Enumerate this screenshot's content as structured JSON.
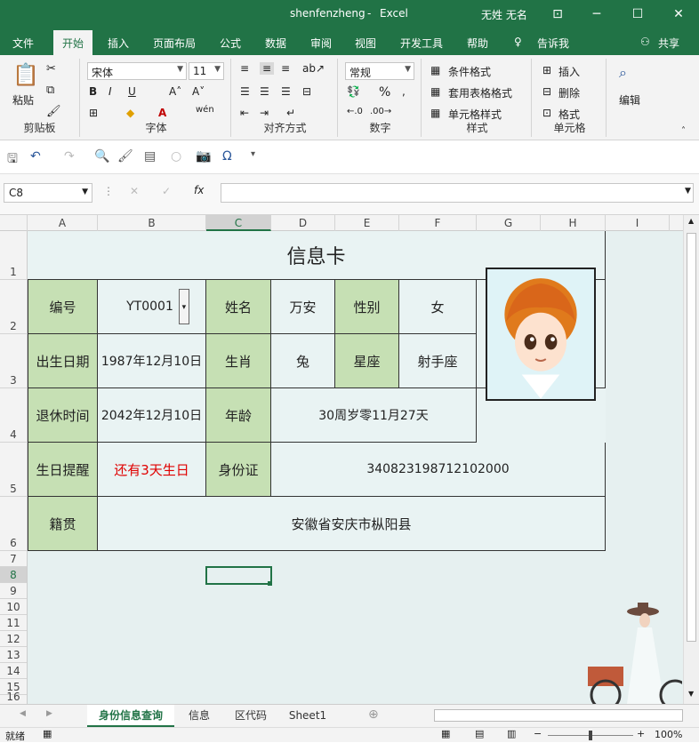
{
  "titlebar": {
    "filename": "shenfenzheng",
    "separator": "-",
    "app": "Excel",
    "user": "无姓 无名"
  },
  "ribbon_tabs": [
    "文件",
    "开始",
    "插入",
    "页面布局",
    "公式",
    "数据",
    "审阅",
    "视图",
    "开发工具",
    "帮助",
    "告诉我",
    "共享"
  ],
  "ribbon": {
    "paste": "粘贴",
    "clipboard": "剪贴板",
    "font_name": "宋体",
    "font_size": "11",
    "font_group": "字体",
    "align_group": "对齐方式",
    "number_format": "常规",
    "number_group": "数字",
    "cond_format": "条件格式",
    "table_format": "套用表格格式",
    "cell_style": "单元格样式",
    "styles_group": "样式",
    "insert": "插入",
    "delete": "删除",
    "format": "格式",
    "cells_group": "单元格",
    "edit": "编辑"
  },
  "formula_bar": {
    "name_box": "C8",
    "formula": ""
  },
  "columns": [
    "A",
    "B",
    "C",
    "D",
    "E",
    "F",
    "G",
    "H",
    "I"
  ],
  "rows": [
    "1",
    "2",
    "3",
    "4",
    "5",
    "6",
    "7",
    "8",
    "9",
    "10",
    "11",
    "12",
    "13",
    "14",
    "15",
    "16"
  ],
  "card": {
    "title": "信息卡",
    "label_id": "编号",
    "id": "YT0001",
    "label_name": "姓名",
    "name": "万安",
    "label_gender": "性别",
    "gender": "女",
    "label_birth": "出生日期",
    "birth": "1987年12月10日",
    "label_zodiac": "生肖",
    "zodiac": "兔",
    "label_star": "星座",
    "star": "射手座",
    "label_retire": "退休时间",
    "retire": "2042年12月10日",
    "label_age": "年龄",
    "age": "30周岁零11月27天",
    "label_bday": "生日提醒",
    "bday": "还有3天生日",
    "label_idcard": "身份证",
    "idcard": "340823198712102000",
    "label_origin": "籍贯",
    "origin": "安徽省安庆市枞阳县"
  },
  "sheet_tabs": [
    "身份信息查询",
    "信息",
    "区代码",
    "Sheet1"
  ],
  "status": {
    "ready": "就绪",
    "zoom": "100%"
  },
  "colors": {
    "excel_green": "#217346",
    "label_fill": "#c6e0b4",
    "reminder_red": "#e00000"
  }
}
